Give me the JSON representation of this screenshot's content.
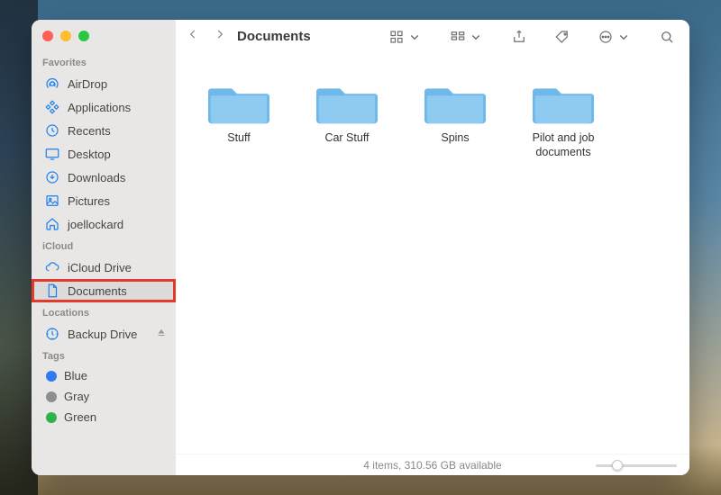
{
  "window": {
    "title": "Documents"
  },
  "sidebar": {
    "favorites": {
      "label": "Favorites",
      "items": [
        {
          "icon": "airdrop-icon",
          "label": "AirDrop"
        },
        {
          "icon": "app-icon",
          "label": "Applications"
        },
        {
          "icon": "recents-icon",
          "label": "Recents"
        },
        {
          "icon": "desktop-icon",
          "label": "Desktop"
        },
        {
          "icon": "downloads-icon",
          "label": "Downloads"
        },
        {
          "icon": "pictures-icon",
          "label": "Pictures"
        },
        {
          "icon": "home-icon",
          "label": "joellockard"
        }
      ]
    },
    "icloud": {
      "label": "iCloud",
      "items": [
        {
          "icon": "cloud-icon",
          "label": "iCloud Drive"
        },
        {
          "icon": "doc-icon",
          "label": "Documents",
          "highlighted": true
        }
      ]
    },
    "locations": {
      "label": "Locations",
      "items": [
        {
          "icon": "timemachine-icon",
          "label": "Backup Drive",
          "eject": true
        }
      ]
    },
    "tags": {
      "label": "Tags",
      "items": [
        {
          "color": "blue",
          "label": "Blue"
        },
        {
          "color": "gray",
          "label": "Gray"
        },
        {
          "color": "green",
          "label": "Green"
        }
      ]
    }
  },
  "folders": [
    {
      "name": "Stuff"
    },
    {
      "name": "Car Stuff"
    },
    {
      "name": "Spins"
    },
    {
      "name": "Pilot and job documents"
    }
  ],
  "status": {
    "text": "4 items, 310.56 GB available"
  }
}
